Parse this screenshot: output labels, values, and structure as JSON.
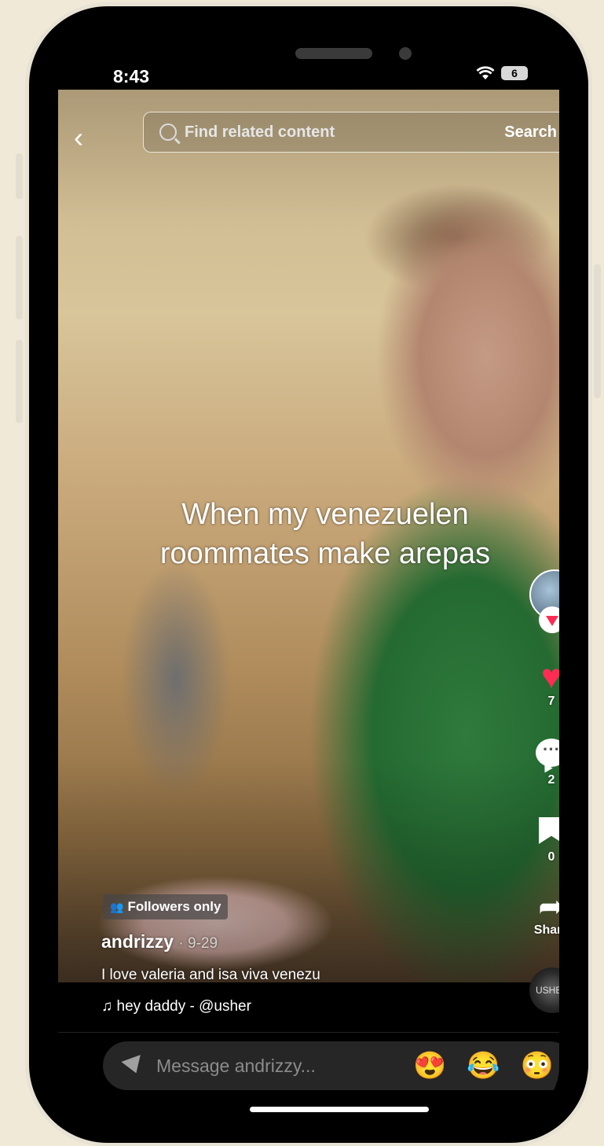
{
  "status_bar": {
    "time": "8:43",
    "battery": "6"
  },
  "search": {
    "placeholder": "Find related content",
    "button": "Search"
  },
  "video": {
    "caption_line1": "When my venezuelen",
    "caption_line2": "roommates make arepas"
  },
  "actions": {
    "likes": "7",
    "comments": "2",
    "saves": "0",
    "share_label": "Share"
  },
  "post": {
    "visibility": "Followers only",
    "author": "andrizzy",
    "date": "· 9-29",
    "description": "I love valeria and isa viva venezu",
    "music": "hey daddy - @usher",
    "disc_label": "USHER"
  },
  "message": {
    "placeholder": "Message andrizzy...",
    "emojis": [
      "😍",
      "😂",
      "😳"
    ]
  },
  "colors": {
    "like": "#fe2c55",
    "background": "#f0e9d8"
  }
}
